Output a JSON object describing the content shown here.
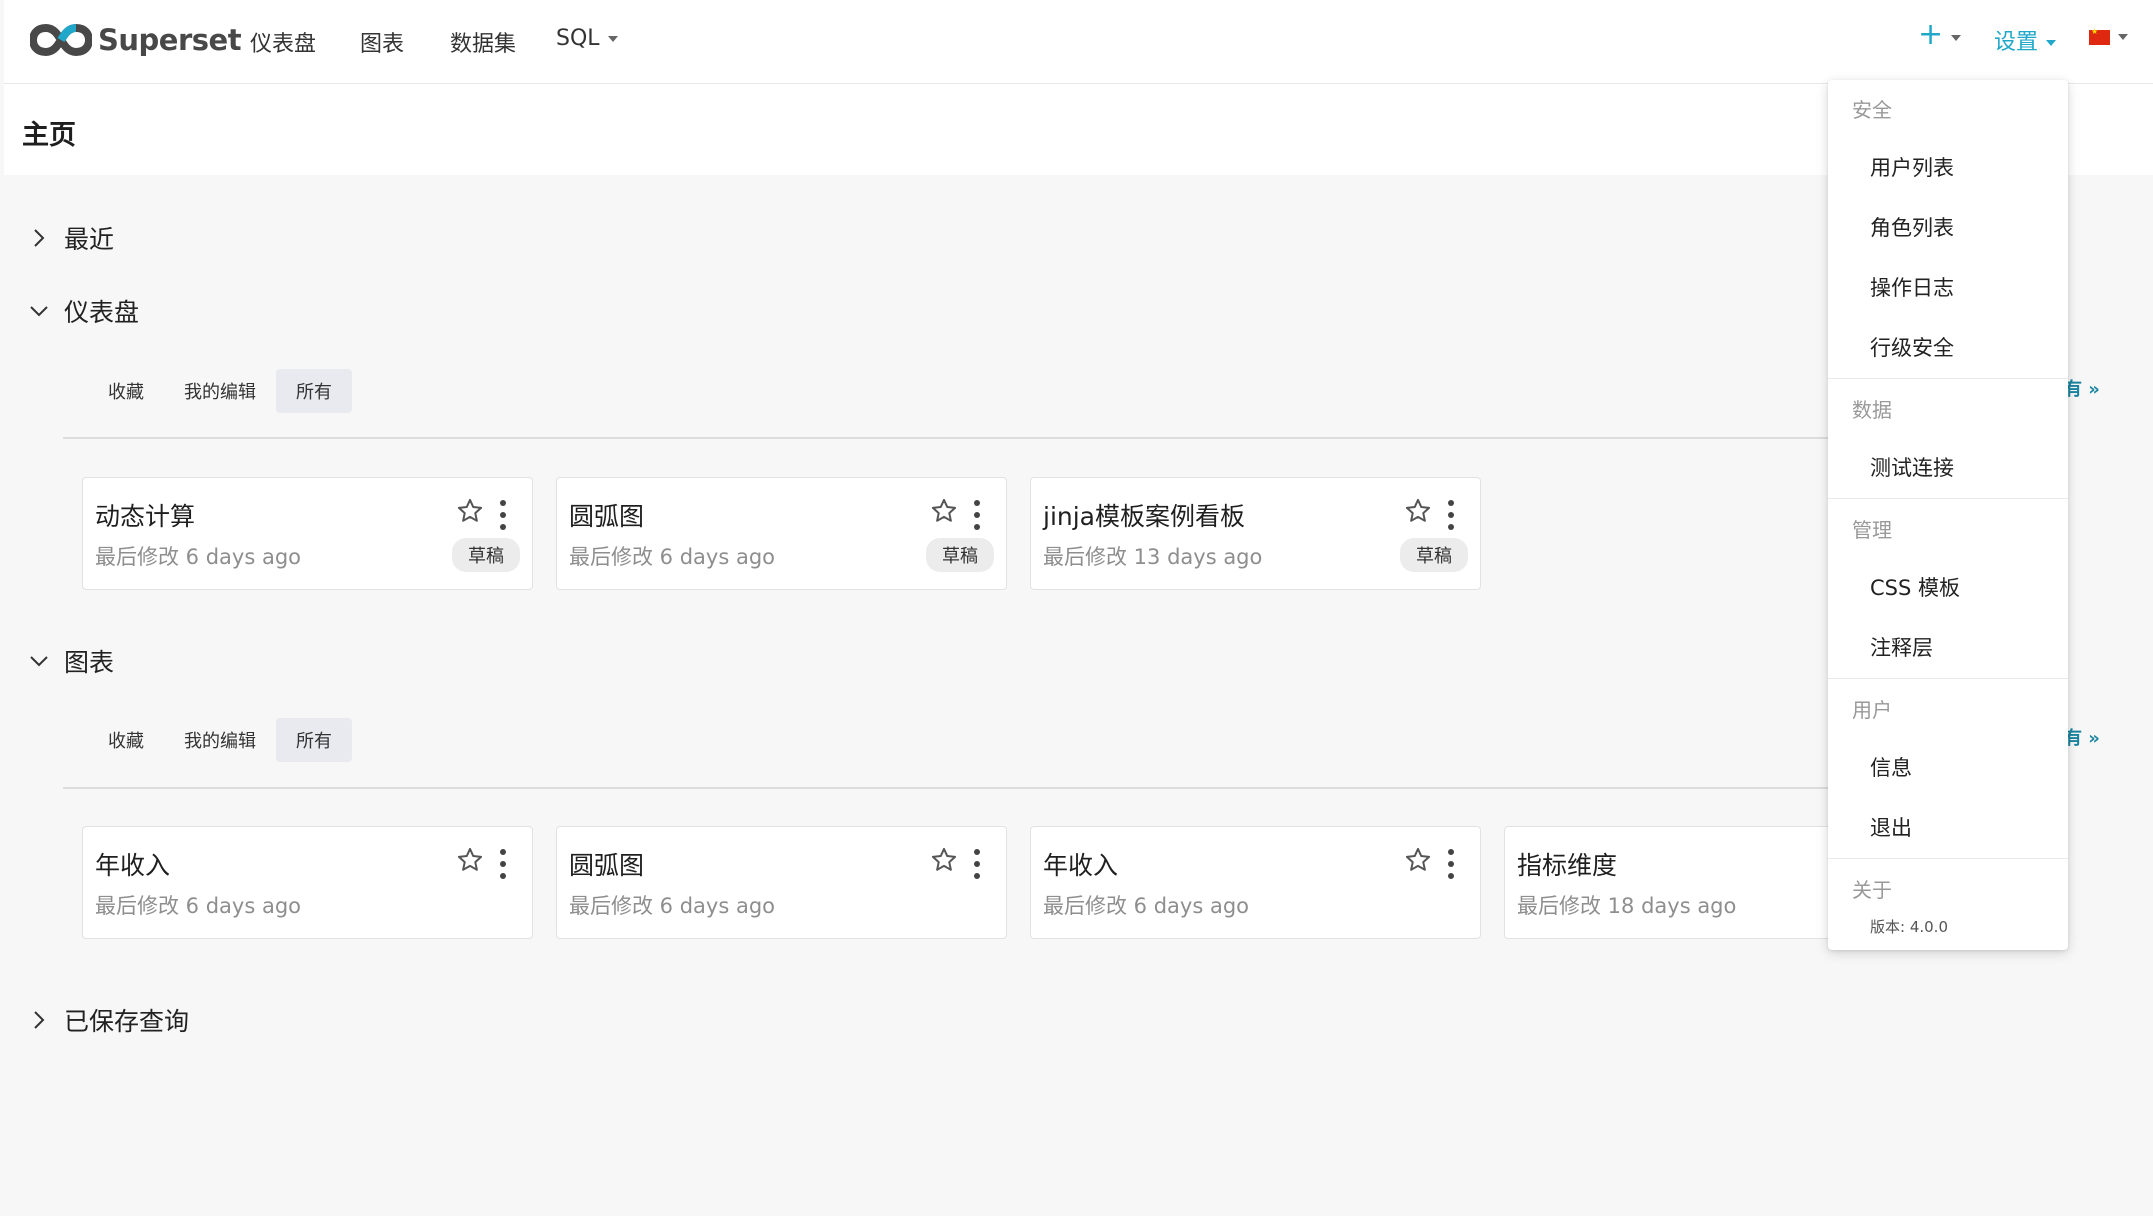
{
  "app": {
    "name": "Superset"
  },
  "nav": {
    "items": [
      "仪表盘",
      "图表",
      "数据集",
      "SQL"
    ]
  },
  "nav_right": {
    "plus": "+",
    "settings": "设置"
  },
  "page_title": "主页",
  "sections": {
    "recent": {
      "label": "最近"
    },
    "dashboards": {
      "label": "仪表盘",
      "tabs": [
        "收藏",
        "我的编辑",
        "所有"
      ],
      "active_tab": "所有",
      "view_all": "有 »",
      "cards": [
        {
          "title": "动态计算",
          "meta": "最后修改 6 days ago",
          "badge": "草稿"
        },
        {
          "title": "圆弧图",
          "meta": "最后修改 6 days ago",
          "badge": "草稿"
        },
        {
          "title": "jinja模板案例看板",
          "meta": "最后修改 13 days ago",
          "badge": "草稿"
        }
      ]
    },
    "charts": {
      "label": "图表",
      "tabs": [
        "收藏",
        "我的编辑",
        "所有"
      ],
      "active_tab": "所有",
      "view_all": "有 »",
      "cards": [
        {
          "title": "年收入",
          "meta": "最后修改 6 days ago"
        },
        {
          "title": "圆弧图",
          "meta": "最后修改 6 days ago"
        },
        {
          "title": "年收入",
          "meta": "最后修改 6 days ago"
        },
        {
          "title": "指标维度",
          "meta": "最后修改 18 days ago"
        }
      ]
    },
    "saved_queries": {
      "label": "已保存查询"
    }
  },
  "settings_menu": {
    "security": {
      "label": "安全",
      "items": [
        "用户列表",
        "角色列表",
        "操作日志",
        "行级安全"
      ]
    },
    "data": {
      "label": "数据",
      "items": [
        "测试连接"
      ]
    },
    "manage": {
      "label": "管理",
      "items": [
        "CSS 模板",
        "注释层"
      ]
    },
    "user": {
      "label": "用户",
      "items": [
        "信息",
        "退出"
      ]
    },
    "about": {
      "label": "关于",
      "version": "版本: 4.0.0"
    }
  },
  "icons": {
    "logo": "superset-infinity-icon",
    "star": "star-outline-icon",
    "kebab": "more-vertical-icon",
    "flag": "china-flag-icon"
  },
  "colors": {
    "accent": "#20a7c9",
    "logo": "#484848",
    "link": "#1a85a0"
  }
}
